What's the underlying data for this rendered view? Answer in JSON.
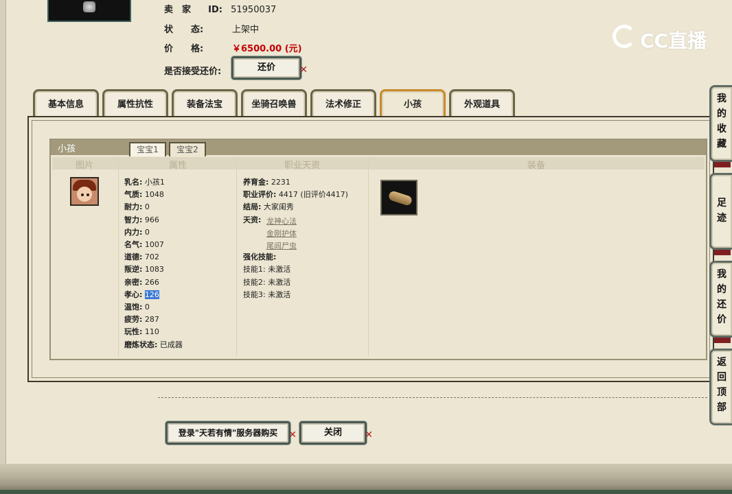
{
  "seller": {
    "label_seller": "卖　家",
    "id_prefix": "ID:",
    "id_value": "51950037",
    "label_status": "状　　态:",
    "status_value": "上架中",
    "label_price": "价　　格:",
    "price_value": "￥6500.00 (元)",
    "label_counter": "是否接受还价:",
    "counter_button": "还价"
  },
  "logo": {
    "text": "CC直播"
  },
  "tabs": [
    {
      "label": "基本信息"
    },
    {
      "label": "属性抗性"
    },
    {
      "label": "装备法宝"
    },
    {
      "label": "坐骑召唤兽"
    },
    {
      "label": "法术修正"
    },
    {
      "label": "小孩"
    },
    {
      "label": "外观道具"
    }
  ],
  "child_section": {
    "title": "小孩",
    "subtabs": [
      "宝宝1",
      "宝宝2"
    ],
    "columns": [
      "图片",
      "属性",
      "职业天资",
      "装备"
    ],
    "attributes": [
      {
        "label": "乳名:",
        "value": "小孩1"
      },
      {
        "label": "气质:",
        "value": "1048"
      },
      {
        "label": "耐力:",
        "value": "0"
      },
      {
        "label": "智力:",
        "value": "966"
      },
      {
        "label": "内力:",
        "value": "0"
      },
      {
        "label": "名气:",
        "value": "1007"
      },
      {
        "label": "道德:",
        "value": "702"
      },
      {
        "label": "叛逆:",
        "value": "1083"
      },
      {
        "label": "亲密:",
        "value": "266"
      },
      {
        "label": "孝心:",
        "value": "126"
      },
      {
        "label": "温饱:",
        "value": "0"
      },
      {
        "label": "疲劳:",
        "value": "287"
      },
      {
        "label": "玩性:",
        "value": "110"
      },
      {
        "label": "磨炼状态:",
        "value": "已成器"
      }
    ],
    "career": {
      "funds_label": "养育金:",
      "funds_value": "2231",
      "rating_label": "职业评价:",
      "rating_value": "4417 (旧评价4417)",
      "ending_label": "结局:",
      "ending_value": "大家闺秀",
      "talent_label": "天资:",
      "talents": [
        "龙神心法",
        "金刚护体",
        "尾闾尸虫"
      ],
      "skills_label": "强化技能:",
      "skills": [
        {
          "label": "技能1:",
          "value": "未激活"
        },
        {
          "label": "技能2:",
          "value": "未激活"
        },
        {
          "label": "技能3:",
          "value": "未激活"
        }
      ]
    }
  },
  "footer": {
    "buy_button": "登录\"天若有情\"服务器购买",
    "close_button": "关闭"
  },
  "side_nav": [
    {
      "label": "我的收藏"
    },
    {
      "label": "足迹"
    },
    {
      "label": "我的还价"
    },
    {
      "label": "返回顶部"
    }
  ]
}
